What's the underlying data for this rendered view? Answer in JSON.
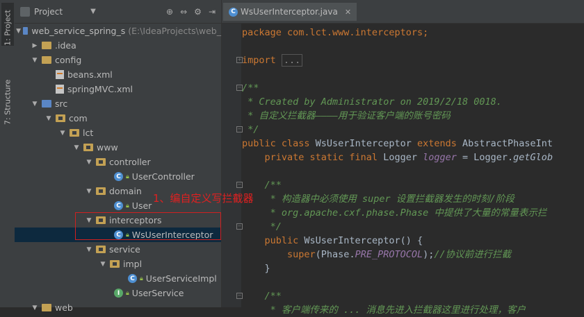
{
  "sidebar": {
    "project_tab": "1: Project",
    "structure_tab": "7: Structure"
  },
  "project_panel": {
    "title": "Project",
    "tree": [
      {
        "label": "web_service_spring_s",
        "path": "(E:\\IdeaProjects\\web_",
        "icon": "module-folder"
      },
      {
        "label": ".idea",
        "icon": "folder"
      },
      {
        "label": "config",
        "icon": "folder"
      },
      {
        "label": "beans.xml",
        "icon": "xml-file"
      },
      {
        "label": "springMVC.xml",
        "icon": "xml-file"
      },
      {
        "label": "src",
        "icon": "source-folder"
      },
      {
        "label": "com",
        "icon": "package"
      },
      {
        "label": "lct",
        "icon": "package"
      },
      {
        "label": "www",
        "icon": "package"
      },
      {
        "label": "controller",
        "icon": "package"
      },
      {
        "label": "UserController",
        "icon": "class"
      },
      {
        "label": "domain",
        "icon": "package"
      },
      {
        "label": "User",
        "icon": "class"
      },
      {
        "label": "interceptors",
        "icon": "package"
      },
      {
        "label": "WsUserInterceptor",
        "icon": "class"
      },
      {
        "label": "service",
        "icon": "package"
      },
      {
        "label": "impl",
        "icon": "package"
      },
      {
        "label": "UserServiceImpl",
        "icon": "class"
      },
      {
        "label": "UserService",
        "icon": "interface"
      },
      {
        "label": "web",
        "icon": "folder"
      }
    ]
  },
  "editor": {
    "tab_label": "WsUserInterceptor.java",
    "code": {
      "l1": "package com.lct.www.interceptors;",
      "l2_kw": "import",
      "l2_hint": "...",
      "l3": "/**",
      "l4": " * Created by Administrator on 2019/2/18 0018.",
      "l5": " * 自定义拦截器————用于验证客户端的账号密码",
      "l6": " */",
      "l7_kw": "public class",
      "l7_name": " WsUserInterceptor ",
      "l7_kw2": "extends",
      "l7_rest": " AbstractPhaseInt",
      "l8_kw": "    private static final",
      "l8_type": " Logger ",
      "l8_field": "logger",
      "l8_eq": " = Logger.",
      "l8_fn": "getGlob",
      "l9": "    /**",
      "l10": "     * 构造器中必须使用 super 设置拦截器发生的时刻/阶段",
      "l11": "     * org.apache.cxf.phase.Phase 中提供了大量的常量表示拦",
      "l12": "     */",
      "l13_kw": "    public",
      "l13_rest": " WsUserInterceptor() {",
      "l14_kw": "        super",
      "l14_a": "(Phase.",
      "l14_const": "PRE_PROTOCOL",
      "l14_b": ");",
      "l14_cm": "//协议前进行拦截",
      "l15": "    }",
      "l16": "    /**",
      "l17": "     * 客户端传来的 ... 消息先进入拦截器这里进行处理，客户"
    }
  },
  "annotation": {
    "text": "1、编自定义写拦截器"
  }
}
